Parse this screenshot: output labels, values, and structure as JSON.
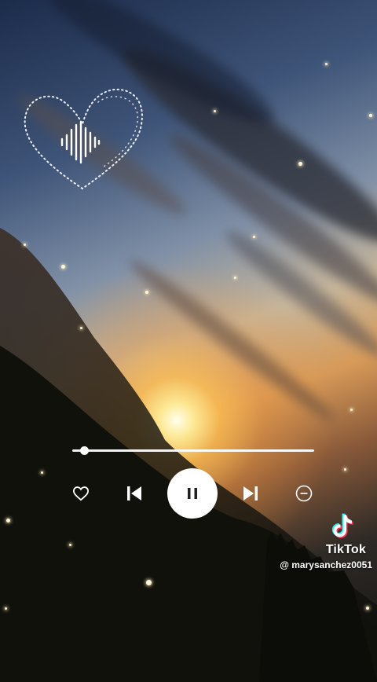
{
  "player": {
    "progress": 0.05,
    "controls": {
      "like": "heart-icon",
      "previous": "skip-previous-icon",
      "play_pause": "pause-icon",
      "next": "skip-next-icon",
      "remove": "minus-circle-icon"
    }
  },
  "watermark": {
    "brand": "TikTok",
    "handle": "@ marysanchez0051"
  },
  "colors": {
    "icon": "#ffffff",
    "pause_glyph": "#222222",
    "tiktok_cyan": "#25F4EE",
    "tiktok_pink": "#FE2C55"
  }
}
